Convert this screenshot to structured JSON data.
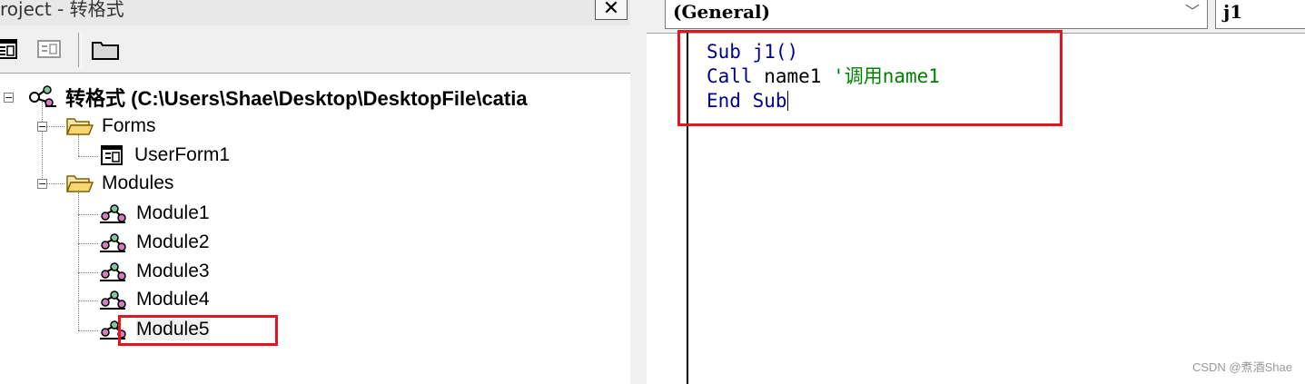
{
  "project_window": {
    "title": "roject - 转格式",
    "close_label": "✕",
    "toolbar": {
      "view_code_icon": "view-code-icon",
      "view_object_icon": "view-object-icon",
      "toggle_folders_icon": "folder-icon"
    },
    "tree": {
      "root": "转格式 (C:\\Users\\Shae\\Desktop\\DesktopFile\\catia",
      "forms_folder": "Forms",
      "forms": [
        "UserForm1"
      ],
      "modules_folder": "Modules",
      "modules": [
        "Module1",
        "Module2",
        "Module3",
        "Module4",
        "Module5"
      ]
    }
  },
  "code_window": {
    "object_combo": "(General)",
    "procedure_combo": "j1",
    "code": {
      "line1_kw": "Sub",
      "line1_rest": " j1()",
      "line2_kw": "Call",
      "line2_rest": " name1 ",
      "line2_comment": "'调用name1",
      "line3_kw": "End Sub"
    }
  },
  "watermark": "CSDN @煮酒Shae",
  "colors": {
    "highlight_box": "#e6141e",
    "keyword": "#00008b",
    "comment": "#008000"
  }
}
